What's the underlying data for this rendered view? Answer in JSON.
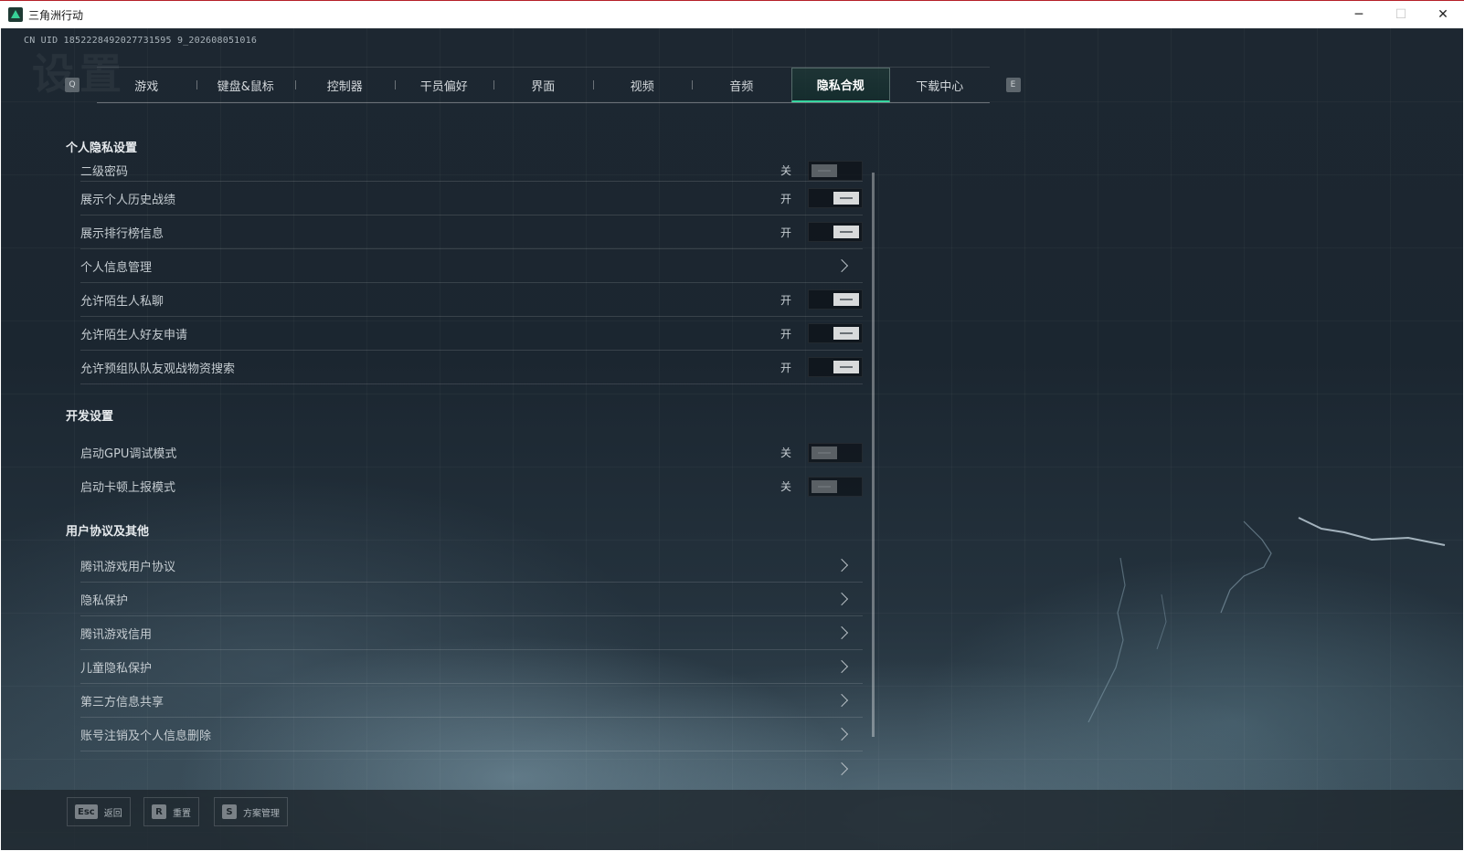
{
  "window": {
    "title": "三角洲行动",
    "minimize": "─",
    "maximize": "☐",
    "close": "✕"
  },
  "header": {
    "uid": "CN UID 1852228492027731595 9_202608051016",
    "bg_word": "设置"
  },
  "tabs": {
    "prev_key": "Q",
    "next_key": "E",
    "items": [
      "游戏",
      "键盘&鼠标",
      "控制器",
      "干员偏好",
      "界面",
      "视频",
      "音频",
      "隐私合规",
      "下载中心"
    ],
    "active": "隐私合规"
  },
  "privacy": {
    "title": "个人隐私设置",
    "second_password": {
      "label": "二级密码",
      "state": "关"
    },
    "show_history": {
      "label": "展示个人历史战绩",
      "state": "开"
    },
    "show_ranking": {
      "label": "展示排行榜信息",
      "state": "开"
    },
    "personal_info": {
      "label": "个人信息管理"
    },
    "stranger_chat": {
      "label": "允许陌生人私聊",
      "state": "开"
    },
    "stranger_friend": {
      "label": "允许陌生人好友申请",
      "state": "开"
    },
    "team_loot_view": {
      "label": "允许预组队队友观战物资搜索",
      "state": "开"
    }
  },
  "dev": {
    "title": "开发设置",
    "gpu_debug": {
      "label": "启动GPU调试模式",
      "state": "关"
    },
    "stutter_report": {
      "label": "启动卡顿上报模式",
      "state": "关"
    }
  },
  "agreements": {
    "title": "用户协议及其他",
    "items": [
      "腾讯游戏用户协议",
      "隐私保护",
      "腾讯游戏信用",
      "儿童隐私保护",
      "第三方信息共享",
      "账号注销及个人信息删除"
    ]
  },
  "footer": {
    "back": {
      "key": "Esc",
      "label": "返回"
    },
    "reset": {
      "key": "R",
      "label": "重置"
    },
    "scheme": {
      "key": "S",
      "label": "方案管理"
    }
  },
  "colors": {
    "accent": "#36d6a0",
    "title_bar_border": "#b62028"
  }
}
